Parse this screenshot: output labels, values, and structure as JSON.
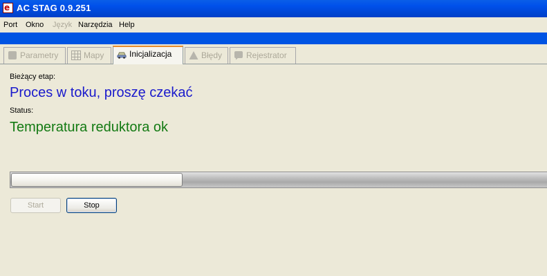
{
  "window": {
    "title": "AC STAG 0.9.251",
    "icon": "ac-stag-logo-icon"
  },
  "menu": {
    "items": [
      {
        "label": "Port",
        "enabled": true
      },
      {
        "label": "Okno",
        "enabled": true
      },
      {
        "label": "Język",
        "enabled": false
      },
      {
        "label": "Narzędzia",
        "enabled": true
      },
      {
        "label": "Help",
        "enabled": true
      }
    ]
  },
  "tabs": [
    {
      "label": "Parametry",
      "icon": "parameters-icon",
      "enabled": false,
      "active": false
    },
    {
      "label": "Mapy",
      "icon": "map-grid-icon",
      "enabled": false,
      "active": false
    },
    {
      "label": "Inicjalizacja",
      "icon": "car-icon",
      "enabled": true,
      "active": true
    },
    {
      "label": "Błędy",
      "icon": "warning-icon",
      "enabled": false,
      "active": false
    },
    {
      "label": "Rejestrator",
      "icon": "recorder-icon",
      "enabled": false,
      "active": false
    }
  ],
  "init": {
    "stage_label": "Bieżący etap:",
    "stage_value": "Proces w toku, proszę czekać",
    "status_label": "Status:",
    "status_value": "Temperatura reduktora ok",
    "progress": 0.32,
    "start_label": "Start",
    "start_enabled": false,
    "stop_label": "Stop",
    "stop_enabled": true
  },
  "colors": {
    "titlebar": "#0050EA",
    "accent_bar": "#0054E3",
    "stage_text": "#1A1ACC",
    "status_text": "#137A13",
    "active_tab_highlight": "#E68B2C"
  }
}
